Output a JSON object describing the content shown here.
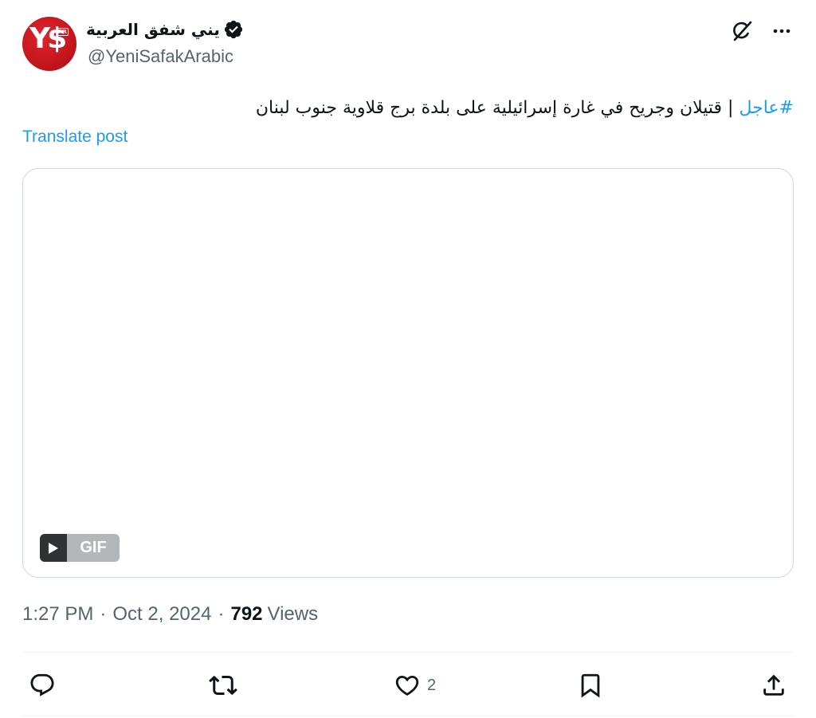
{
  "author": {
    "display_name": "يني شفق العربية",
    "handle": "@YeniSafakArabic",
    "avatar_logo_text": "Y$",
    "avatar_badge_text": "AR",
    "verified": true
  },
  "post": {
    "hashtag": "#عاجل",
    "text": " | قتيلان وجريح في غارة إسرائيلية على بلدة برج قلاوية جنوب لبنان",
    "translate_label": "Translate post"
  },
  "media": {
    "badge_label": "GIF"
  },
  "meta": {
    "time": "1:27 PM",
    "date": "Oct 2, 2024",
    "separator": "·",
    "views_count": "792",
    "views_label": "Views"
  },
  "actions": {
    "like_count": "2"
  },
  "colors": {
    "accent": "#1d9bf0",
    "text_primary": "#0f1419",
    "text_secondary": "#536471",
    "brand_red": "#c4161d"
  },
  "icons": {
    "verified": "verified-badge-icon",
    "grok": "grok-icon",
    "more": "more-icon",
    "reply": "reply-icon",
    "repost": "repost-icon",
    "like": "like-icon",
    "bookmark": "bookmark-icon",
    "share": "share-icon",
    "play": "play-icon"
  }
}
